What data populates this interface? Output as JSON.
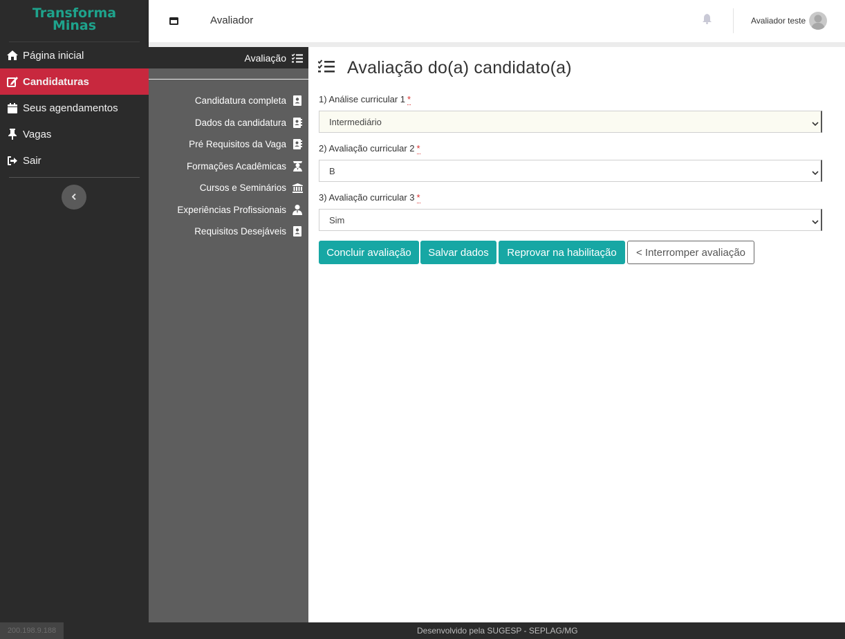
{
  "app": {
    "logo_line1": "Transforma",
    "logo_line2": "Minas",
    "colors": {
      "brand": "#1ea38c",
      "active": "#c8283e",
      "accent": "#17a7a4",
      "sidebar": "#2b2b2b",
      "subnav": "#5e5e5e"
    }
  },
  "sidebar": {
    "items": [
      {
        "label": "Página inicial",
        "icon": "home-icon"
      },
      {
        "label": "Candidaturas",
        "icon": "edit-icon",
        "active": true
      },
      {
        "label": "Seus agendamentos",
        "icon": "calendar-icon"
      },
      {
        "label": "Vagas",
        "icon": "pin-icon"
      },
      {
        "label": "Sair",
        "icon": "sign-out-icon"
      }
    ],
    "collapse_icon": "chevron-left-icon"
  },
  "header": {
    "title": "Avaliador",
    "menu_icon": "window-icon",
    "bell_icon": "bell-icon",
    "user_name": "Avaliador teste",
    "avatar_icon": "user-avatar-icon"
  },
  "subnav": {
    "heading": "Avaliação",
    "heading_icon": "tasks-icon",
    "items": [
      {
        "label": "Candidatura completa",
        "icon": "id-card-icon"
      },
      {
        "label": "Dados da candidatura",
        "icon": "address-book-icon"
      },
      {
        "label": "Pré Requisitos da Vaga",
        "icon": "address-book-icon"
      },
      {
        "label": "Formações Acadêmicas",
        "icon": "graduate-icon"
      },
      {
        "label": "Cursos e Seminários",
        "icon": "university-icon"
      },
      {
        "label": "Experiências Profissionais",
        "icon": "user-tie-icon"
      },
      {
        "label": "Requisitos Desejáveis",
        "icon": "id-card-icon"
      }
    ]
  },
  "main": {
    "title": "Avaliação do(a) candidato(a)",
    "title_icon": "tasks-icon",
    "fields": [
      {
        "label": "1) Análise curricular 1",
        "required": "*",
        "value": "Intermediário"
      },
      {
        "label": "2) Avaliação curricular 2",
        "required": "*",
        "value": "B"
      },
      {
        "label": "3) Avaliação curricular 3",
        "required": "*",
        "value": "Sim"
      }
    ],
    "buttons": {
      "conclude": "Concluir avaliação",
      "save": "Salvar dados",
      "reject": "Reprovar na habilitação",
      "interrupt": "< Interromper avaliação"
    }
  },
  "footer": {
    "credit": "Desenvolvido pela SUGESP - SEPLAG/MG",
    "ip": "200.198.9.188"
  }
}
